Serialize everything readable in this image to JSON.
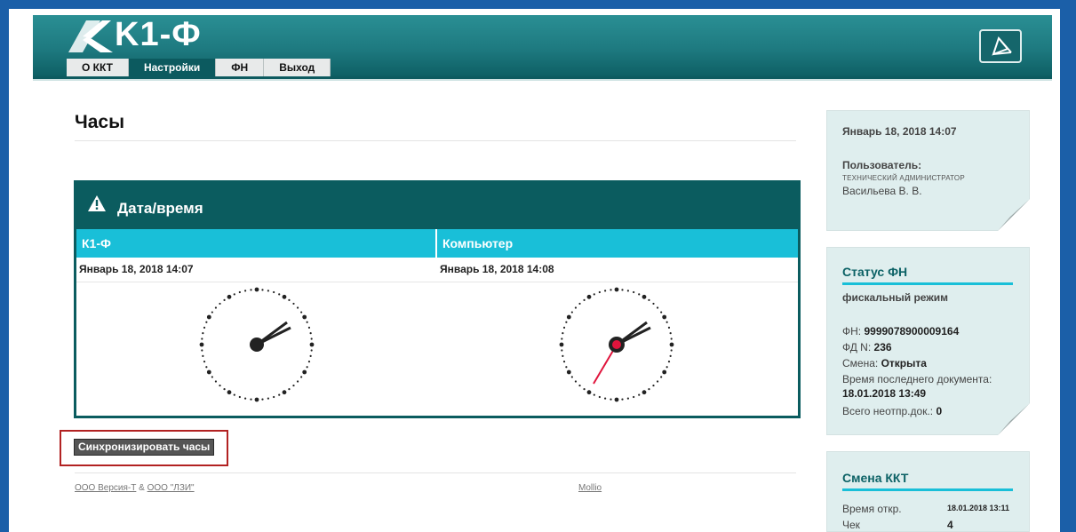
{
  "app": {
    "logo_text": "K1-Ф",
    "tabs": [
      {
        "label": "О ККТ",
        "active": false
      },
      {
        "label": "Настройки",
        "active": true
      },
      {
        "label": "ФН",
        "active": false
      },
      {
        "label": "Выход",
        "active": false
      }
    ]
  },
  "page": {
    "title": "Часы"
  },
  "panel": {
    "title": "Дата/время",
    "columns": [
      "К1-Ф",
      "Компьютер"
    ],
    "device_datetime": "Январь 18, 2018 14:07",
    "computer_datetime": "Январь 18, 2018 14:08"
  },
  "actions": {
    "sync_label": "Синхронизировать часы"
  },
  "footer": {
    "left_link1": "ООО Версия-Т",
    "left_sep": " & ",
    "left_link2": "ООО \"ЛЗИ\"",
    "right_link": "Mollio"
  },
  "sidebar": {
    "user_card": {
      "datetime": "Январь 18, 2018 14:07",
      "user_label": "Пользователь:",
      "role": "ТЕХНИЧЕСКИЙ АДМИНИСТРАТОР",
      "name": "Васильева В. В."
    },
    "fn_card": {
      "title": "Статус ФН",
      "mode": "фискальный режим",
      "fn_label": "ФН: ",
      "fn_value": "9999078900009164",
      "fd_label": "ФД N: ",
      "fd_value": "236",
      "shift_label": "Смена: ",
      "shift_value": "Открыта",
      "lastdoc_label": "Время последнего документа:",
      "lastdoc_value": "18.01.2018 13:49",
      "unsent_label": "Всего неотпр.док.: ",
      "unsent_value": "0"
    },
    "shift_card": {
      "title": "Смена ККТ",
      "open_label": "Время откр.",
      "open_value": "18.01.2018 13:11",
      "check_label": "Чек",
      "check_value": "4"
    }
  },
  "colors": {
    "header_teal": "#1e7a80",
    "panel_dark": "#0b5c5f",
    "column_cyan": "#19bfd8",
    "frame_blue": "#1b5fa8",
    "highlight_red": "#b22222",
    "second_hand": "#e0143c"
  }
}
